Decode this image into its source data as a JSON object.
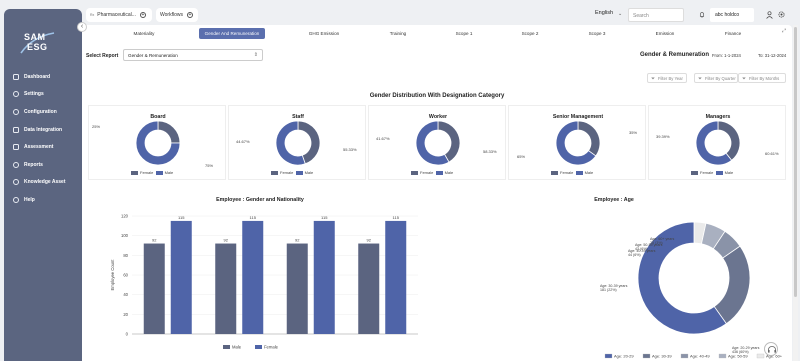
{
  "sidebar": {
    "logo_line1": "SAM",
    "logo_line2": "ESG",
    "items": [
      {
        "label": "Dashboard"
      },
      {
        "label": "Settings"
      },
      {
        "label": "Configuration"
      },
      {
        "label": "Data Integration"
      },
      {
        "label": "Assessment"
      },
      {
        "label": "Reports"
      },
      {
        "label": "Knowledge Asset"
      },
      {
        "label": "Help"
      }
    ]
  },
  "topbar": {
    "company_tab": "Pharmaceutical...",
    "company_tab_badge": "Rx",
    "workflows_tab": "Workflows",
    "language": "English",
    "search_placeholder": "Search",
    "user_name": "abc holdco"
  },
  "tabs": [
    {
      "label": "Materiality",
      "active": false
    },
    {
      "label": "Gender And Remuneration",
      "active": true
    },
    {
      "label": "GHG Emission",
      "active": false
    },
    {
      "label": "Training",
      "active": false
    },
    {
      "label": "Scope 1",
      "active": false
    },
    {
      "label": "Scope 2",
      "active": false
    },
    {
      "label": "Scope 3",
      "active": false
    },
    {
      "label": "Emission",
      "active": false
    },
    {
      "label": "Finance",
      "active": false
    }
  ],
  "report": {
    "select_label": "Select Report",
    "selected": "Gender & Remuneration",
    "heading": "Gender & Remuneration",
    "from_label": "From:",
    "from_date": "1-1-2024",
    "to_label": "To:",
    "to_date": "31-12-2024"
  },
  "filters": [
    "Filter By Year",
    "Filter By Quarter",
    "Filter By Months"
  ],
  "colors": {
    "accent": "#5b6fae",
    "sidebar": "#5b6580",
    "female": "#5b6480",
    "male": "#4f64a8"
  },
  "section_title": "Gender Distribution With Designation Category",
  "chart_data": [
    {
      "type": "pie",
      "title": "Board",
      "labels": [
        "Female",
        "Male"
      ],
      "values": [
        25,
        75
      ],
      "data_labels": [
        "25%",
        "75%"
      ],
      "legend": "bottom"
    },
    {
      "type": "pie",
      "title": "Staff",
      "labels": [
        "Female",
        "Male"
      ],
      "values": [
        44.67,
        55.33
      ],
      "data_labels": [
        "44.67%",
        "55.33%"
      ],
      "legend": "bottom"
    },
    {
      "type": "pie",
      "title": "Worker",
      "labels": [
        "Female",
        "Male"
      ],
      "values": [
        41.67,
        58.33
      ],
      "data_labels": [
        "41.67%",
        "58.33%"
      ],
      "legend": "bottom"
    },
    {
      "type": "pie",
      "title": "Senior Management",
      "labels": [
        "Female",
        "Male"
      ],
      "values": [
        35,
        65
      ],
      "data_labels": [
        "35%",
        "65%"
      ],
      "legend": "bottom"
    },
    {
      "type": "pie",
      "title": "Managers",
      "labels": [
        "Female",
        "Male"
      ],
      "values": [
        39.39,
        60.61
      ],
      "data_labels": [
        "39.39%",
        "60.61%"
      ],
      "legend": "bottom"
    },
    {
      "type": "bar",
      "title": "Employee : Gender and Nationality",
      "ylabel": "Employee Count",
      "ylim": [
        0,
        120
      ],
      "yticks": [
        0,
        20,
        40,
        60,
        80,
        100,
        120
      ],
      "categories": [
        "",
        "",
        "",
        ""
      ],
      "series": [
        {
          "name": "Male",
          "values": [
            92,
            92,
            92,
            92
          ]
        },
        {
          "name": "Female",
          "values": [
            115,
            115,
            115,
            115
          ]
        }
      ],
      "data_labels": [
        [
          "92",
          "92",
          "92",
          "92"
        ],
        [
          "115",
          "115",
          "115",
          "115"
        ]
      ],
      "legend": "bottom"
    },
    {
      "type": "pie",
      "title": "Employee : Age",
      "labels": [
        "Age: 20-29",
        "Age: 30-39",
        "Age: 40-49",
        "Age: 50-59",
        "Age: 60+"
      ],
      "values": [
        436,
        181,
        44,
        43,
        25
      ],
      "data_labels": [
        "Age: 20-29 years\n436 (60%)",
        "Age: 30-39 years\n181 (22%)",
        "Age: 40-49 years\n44 (6%)",
        "Age: 50-59 years\n43 (6%)",
        "Age: 60+ years\n25 (3%)"
      ],
      "colors": [
        "#4f64a8",
        "#6b7590",
        "#8a93a8",
        "#a9b0c0",
        "#eaeaea"
      ],
      "legend": "bottom"
    }
  ]
}
